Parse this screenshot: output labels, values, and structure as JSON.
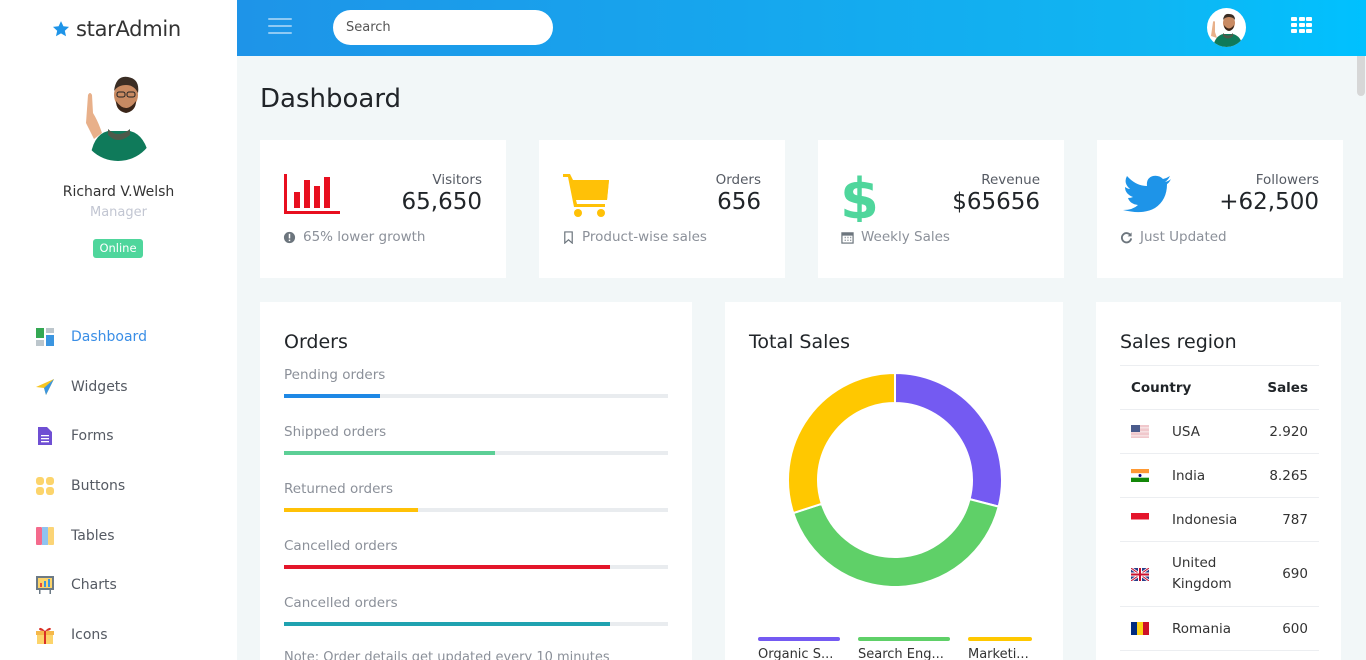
{
  "brand": {
    "name": "starAdmin",
    "icon": "star-icon"
  },
  "profile": {
    "name": "Richard V.Welsh",
    "role": "Manager",
    "status": "Online"
  },
  "sidebar": {
    "items": [
      {
        "label": "Dashboard",
        "icon": "dashboard-icon",
        "active": true
      },
      {
        "label": "Widgets",
        "icon": "paper-plane-icon",
        "active": false
      },
      {
        "label": "Forms",
        "icon": "form-document-icon",
        "active": false
      },
      {
        "label": "Buttons",
        "icon": "buttons-grid-icon",
        "active": false
      },
      {
        "label": "Tables",
        "icon": "table-icon",
        "active": false
      },
      {
        "label": "Charts",
        "icon": "chart-board-icon",
        "active": false
      },
      {
        "label": "Icons",
        "icon": "gift-icon",
        "active": false
      }
    ]
  },
  "topbar": {
    "search_placeholder": "Search",
    "menu_icon": "hamburger-icon",
    "apps_icon": "apps-grid-icon"
  },
  "colors": {
    "topbar_start": "#1e94e8",
    "topbar_end": "#00c1ff",
    "active_nav": "#3a8ee6",
    "online": "#4fd69c"
  },
  "page": {
    "title": "Dashboard"
  },
  "stats": [
    {
      "label": "Visitors",
      "value": "65,650",
      "footer": "65% lower growth",
      "icon": "bar-chart-icon",
      "footer_icon": "exclamation-circle-icon",
      "color": "#e80f1f"
    },
    {
      "label": "Orders",
      "value": "656",
      "footer": "Product-wise sales",
      "icon": "shopping-cart-icon",
      "footer_icon": "bookmark-icon",
      "color": "#ffc107"
    },
    {
      "label": "Revenue",
      "value": "$65656",
      "footer": "Weekly Sales",
      "icon": "dollar-icon",
      "footer_icon": "calendar-icon",
      "color": "#4fd69c"
    },
    {
      "label": "Followers",
      "value": "+62,500",
      "footer": "Just Updated",
      "icon": "twitter-icon",
      "footer_icon": "refresh-icon",
      "color": "#1e94e8"
    }
  ],
  "orders": {
    "title": "Orders",
    "rows": [
      {
        "label": "Pending orders",
        "percent": 25,
        "color": "#1e88e5"
      },
      {
        "label": "Shipped orders",
        "percent": 55,
        "color": "#5ccf96"
      },
      {
        "label": "Returned orders",
        "percent": 35,
        "color": "#ffc107"
      },
      {
        "label": "Cancelled orders",
        "percent": 85,
        "color": "#e3162a"
      },
      {
        "label": "Cancelled orders",
        "percent": 85,
        "color": "#1fa2b0"
      }
    ],
    "note": "Note: Order details get updated every 10 minutes"
  },
  "total_sales": {
    "title": "Total Sales",
    "legend": [
      {
        "label": "Organic S...",
        "color": "#745af2"
      },
      {
        "label": "Search Eng...",
        "color": "#5fd068"
      },
      {
        "label": "Marketi...",
        "color": "#ffc800"
      }
    ]
  },
  "chart_data": {
    "type": "pie",
    "title": "Total Sales",
    "categories": [
      "Organic Search",
      "Search Engine",
      "Marketing"
    ],
    "values": [
      29,
      41,
      30
    ],
    "colors": [
      "#745af2",
      "#5fd068",
      "#ffc800"
    ],
    "donut": true,
    "legend": "bottom"
  },
  "sales_region": {
    "title": "Sales region",
    "columns": [
      "Country",
      "Sales"
    ],
    "rows": [
      {
        "flag": "usa-flag-icon",
        "country": "USA",
        "sales": "2.920"
      },
      {
        "flag": "india-flag-icon",
        "country": "India",
        "sales": "8.265"
      },
      {
        "flag": "indonesia-flag-icon",
        "country": "Indonesia",
        "sales": "787"
      },
      {
        "flag": "uk-flag-icon",
        "country": "United Kingdom",
        "sales": "690"
      },
      {
        "flag": "romania-flag-icon",
        "country": "Romania",
        "sales": "600"
      }
    ]
  }
}
